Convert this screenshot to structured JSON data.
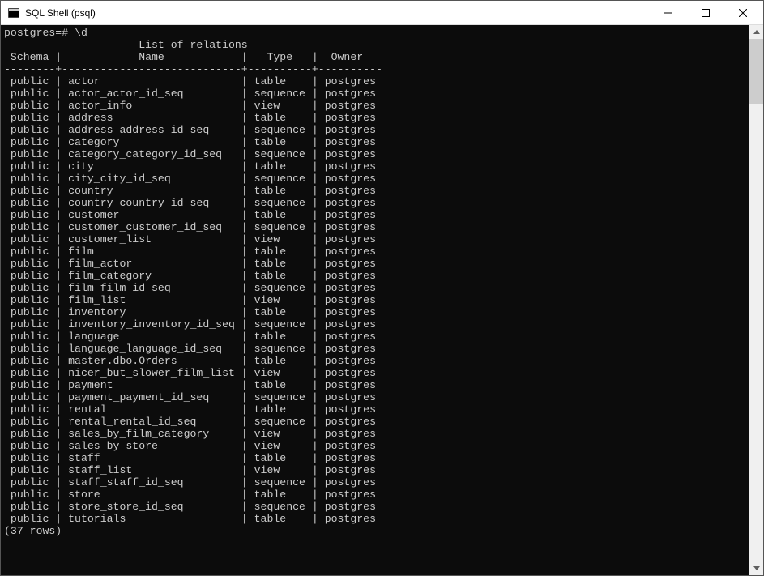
{
  "window": {
    "title": "SQL Shell (psql)"
  },
  "terminal": {
    "prompt": "postgres=# \\d",
    "list_title": "List of relations",
    "col_schema": "Schema",
    "col_name": "Name",
    "col_type": "Type",
    "col_owner": "Owner",
    "rows": [
      {
        "schema": "public",
        "name": "actor",
        "type": "table",
        "owner": "postgres"
      },
      {
        "schema": "public",
        "name": "actor_actor_id_seq",
        "type": "sequence",
        "owner": "postgres"
      },
      {
        "schema": "public",
        "name": "actor_info",
        "type": "view",
        "owner": "postgres"
      },
      {
        "schema": "public",
        "name": "address",
        "type": "table",
        "owner": "postgres"
      },
      {
        "schema": "public",
        "name": "address_address_id_seq",
        "type": "sequence",
        "owner": "postgres"
      },
      {
        "schema": "public",
        "name": "category",
        "type": "table",
        "owner": "postgres"
      },
      {
        "schema": "public",
        "name": "category_category_id_seq",
        "type": "sequence",
        "owner": "postgres"
      },
      {
        "schema": "public",
        "name": "city",
        "type": "table",
        "owner": "postgres"
      },
      {
        "schema": "public",
        "name": "city_city_id_seq",
        "type": "sequence",
        "owner": "postgres"
      },
      {
        "schema": "public",
        "name": "country",
        "type": "table",
        "owner": "postgres"
      },
      {
        "schema": "public",
        "name": "country_country_id_seq",
        "type": "sequence",
        "owner": "postgres"
      },
      {
        "schema": "public",
        "name": "customer",
        "type": "table",
        "owner": "postgres"
      },
      {
        "schema": "public",
        "name": "customer_customer_id_seq",
        "type": "sequence",
        "owner": "postgres"
      },
      {
        "schema": "public",
        "name": "customer_list",
        "type": "view",
        "owner": "postgres"
      },
      {
        "schema": "public",
        "name": "film",
        "type": "table",
        "owner": "postgres"
      },
      {
        "schema": "public",
        "name": "film_actor",
        "type": "table",
        "owner": "postgres"
      },
      {
        "schema": "public",
        "name": "film_category",
        "type": "table",
        "owner": "postgres"
      },
      {
        "schema": "public",
        "name": "film_film_id_seq",
        "type": "sequence",
        "owner": "postgres"
      },
      {
        "schema": "public",
        "name": "film_list",
        "type": "view",
        "owner": "postgres"
      },
      {
        "schema": "public",
        "name": "inventory",
        "type": "table",
        "owner": "postgres"
      },
      {
        "schema": "public",
        "name": "inventory_inventory_id_seq",
        "type": "sequence",
        "owner": "postgres"
      },
      {
        "schema": "public",
        "name": "language",
        "type": "table",
        "owner": "postgres"
      },
      {
        "schema": "public",
        "name": "language_language_id_seq",
        "type": "sequence",
        "owner": "postgres"
      },
      {
        "schema": "public",
        "name": "master.dbo.Orders",
        "type": "table",
        "owner": "postgres"
      },
      {
        "schema": "public",
        "name": "nicer_but_slower_film_list",
        "type": "view",
        "owner": "postgres"
      },
      {
        "schema": "public",
        "name": "payment",
        "type": "table",
        "owner": "postgres"
      },
      {
        "schema": "public",
        "name": "payment_payment_id_seq",
        "type": "sequence",
        "owner": "postgres"
      },
      {
        "schema": "public",
        "name": "rental",
        "type": "table",
        "owner": "postgres"
      },
      {
        "schema": "public",
        "name": "rental_rental_id_seq",
        "type": "sequence",
        "owner": "postgres"
      },
      {
        "schema": "public",
        "name": "sales_by_film_category",
        "type": "view",
        "owner": "postgres"
      },
      {
        "schema": "public",
        "name": "sales_by_store",
        "type": "view",
        "owner": "postgres"
      },
      {
        "schema": "public",
        "name": "staff",
        "type": "table",
        "owner": "postgres"
      },
      {
        "schema": "public",
        "name": "staff_list",
        "type": "view",
        "owner": "postgres"
      },
      {
        "schema": "public",
        "name": "staff_staff_id_seq",
        "type": "sequence",
        "owner": "postgres"
      },
      {
        "schema": "public",
        "name": "store",
        "type": "table",
        "owner": "postgres"
      },
      {
        "schema": "public",
        "name": "store_store_id_seq",
        "type": "sequence",
        "owner": "postgres"
      },
      {
        "schema": "public",
        "name": "tutorials",
        "type": "table",
        "owner": "postgres"
      }
    ],
    "footer": "(37 rows)"
  }
}
